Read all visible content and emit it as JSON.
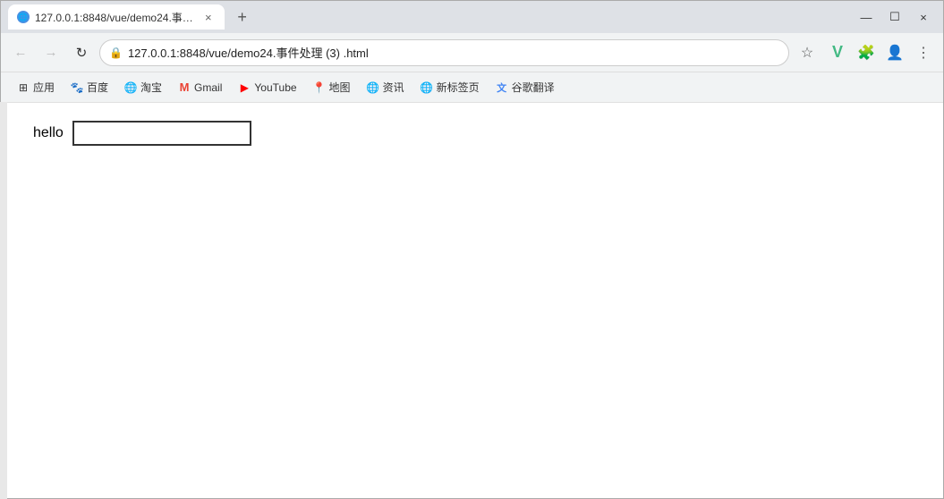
{
  "window": {
    "title": "127.0.0.1:8848/vue/demo24.事件处理 (3) .html",
    "tab_icon": "🌐",
    "close_label": "×",
    "minimize_label": "—",
    "maximize_label": "☐"
  },
  "navbar": {
    "back_label": "←",
    "forward_label": "→",
    "refresh_label": "↻",
    "address": "127.0.0.1:8848/vue/demo24.事件处理 (3) .html",
    "star_label": "☆"
  },
  "bookmarks": [
    {
      "id": "apps",
      "icon": "⊞",
      "label": "应用"
    },
    {
      "id": "baidu",
      "icon": "🐾",
      "label": "百度"
    },
    {
      "id": "taobao",
      "icon": "🌐",
      "label": "淘宝"
    },
    {
      "id": "gmail",
      "icon": "M",
      "label": "Gmail"
    },
    {
      "id": "youtube",
      "icon": "▶",
      "label": "YouTube"
    },
    {
      "id": "maps",
      "icon": "📍",
      "label": "地图"
    },
    {
      "id": "news",
      "icon": "🌐",
      "label": "资讯"
    },
    {
      "id": "newtab",
      "icon": "🌐",
      "label": "新标签页"
    },
    {
      "id": "translate",
      "icon": "🔤",
      "label": "谷歌翻译"
    }
  ],
  "page": {
    "hello_label": "hello",
    "input_value": ""
  },
  "extensions": {
    "vue": "V",
    "puzzle": "🧩",
    "avatar": "👤",
    "menu": "⋮"
  },
  "new_tab_label": "+"
}
